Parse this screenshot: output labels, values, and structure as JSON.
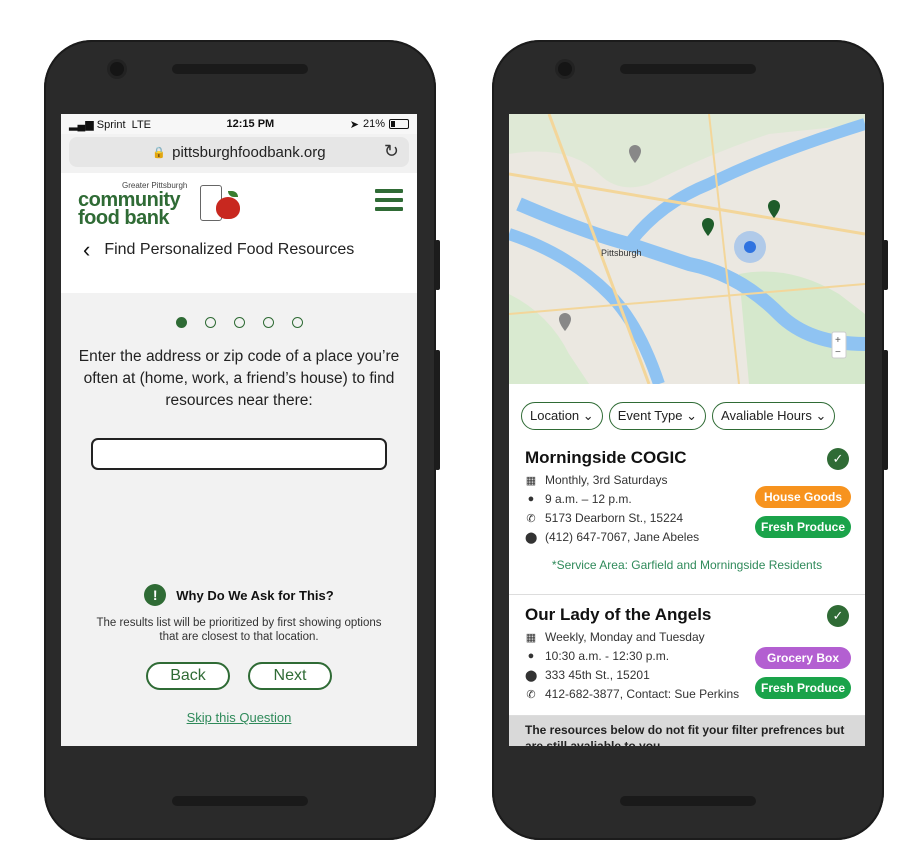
{
  "left": {
    "status": {
      "carrier": "Sprint",
      "network": "LTE",
      "time": "12:15 PM",
      "battery": "21%"
    },
    "url": "pittsburghfoodbank.org",
    "logo": {
      "small": "Greater Pittsburgh",
      "line1": "community",
      "line2": "food bank"
    },
    "title": "Find Personalized Food Resources",
    "progress": {
      "step": 1,
      "total": 5
    },
    "prompt": "Enter the address or zip code of a place you’re often at (home, work, a friend’s house) to find resources near there:",
    "input": {
      "value": "",
      "placeholder": ""
    },
    "why": {
      "heading": "Why Do We Ask for This?",
      "text": "The results list will be prioritized by first showing options that are closest to that location."
    },
    "buttons": {
      "back": "Back",
      "next": "Next"
    },
    "skip": "Skip this Question"
  },
  "right": {
    "map": {
      "city_label": "Pittsburgh",
      "zoom_in": "+",
      "zoom_out": "−"
    },
    "filters": [
      "Location",
      "Event Type",
      "Avaliable Hours"
    ],
    "cards": [
      {
        "title": "Morningside COGIC",
        "schedule": "Monthly, 3rd Saturdays",
        "hours": "9 a.m. – 12 p.m.",
        "address": "5173 Dearborn St., 15224",
        "contact": "(412) 647-7067, Jane Abeles",
        "tags": [
          "House Goods",
          "Fresh Produce"
        ],
        "service": "*Service Area: Garfield and Morningside Residents"
      },
      {
        "title": "Our Lady of the Angels",
        "schedule": "Weekly, Monday and Tuesday",
        "hours": "10:30 a.m. - 12:30 p.m.",
        "address": "333 45th St., 15201",
        "contact": "412-682-3877, Contact: Sue Perkins",
        "tags": [
          "Grocery Box",
          "Fresh Produce"
        ]
      }
    ],
    "footer_note": "The resources below do not fit your filter prefrences but are still avaliable to you."
  },
  "colors": {
    "brand_green": "#2f6b35",
    "tag_orange": "#f7931e",
    "tag_green": "#1aa34a",
    "tag_purple": "#b35fd1"
  }
}
